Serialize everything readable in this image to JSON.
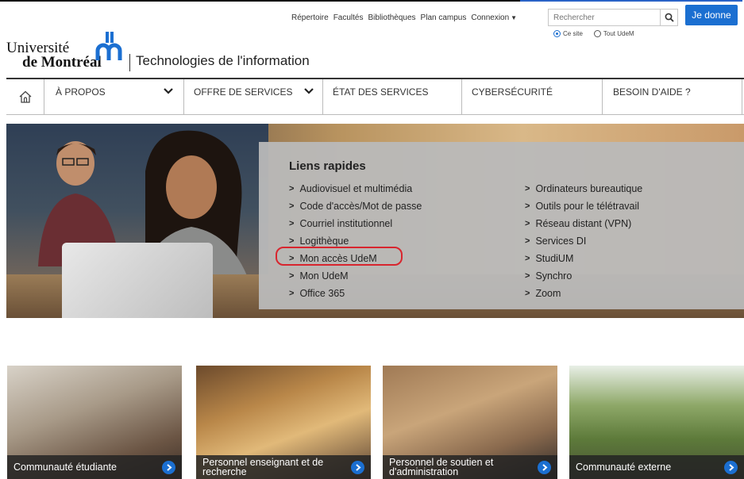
{
  "top_links": {
    "repertoire": "Répertoire",
    "facultes": "Facultés",
    "bibliotheques": "Bibliothèques",
    "plan_campus": "Plan campus",
    "connexion": "Connexion"
  },
  "search": {
    "placeholder": "Rechercher",
    "scope_site": "Ce site",
    "scope_all": "Tout UdeM",
    "selected_scope": "Ce site"
  },
  "give_button": "Je donne",
  "brand": {
    "line1": "Université",
    "line2": "de Montréal",
    "unit": "Technologies de l'information"
  },
  "nav": [
    {
      "label": "À PROPOS",
      "has_dropdown": true
    },
    {
      "label": "OFFRE DE SERVICES",
      "has_dropdown": true
    },
    {
      "label": "ÉTAT DES SERVICES",
      "has_dropdown": false
    },
    {
      "label": "CYBERSÉCURITÉ",
      "has_dropdown": false
    },
    {
      "label": "BESOIN D'AIDE ?",
      "has_dropdown": false
    }
  ],
  "quick_links": {
    "title": "Liens rapides",
    "col1": [
      "Audiovisuel et multimédia",
      "Code d'accès/Mot de passe",
      "Courriel institutionnel",
      "Logithèque",
      "Mon accès UdeM",
      "Mon UdeM",
      "Office 365"
    ],
    "col2": [
      "Ordinateurs bureautique",
      "Outils pour le télétravail",
      "Réseau distant (VPN)",
      "Services DI",
      "StudiUM",
      "Synchro",
      "Zoom"
    ],
    "highlighted": "Mon accès UdeM"
  },
  "cards": [
    {
      "label": "Communauté étudiante"
    },
    {
      "label": "Personnel enseignant et de recherche"
    },
    {
      "label": "Personnel de soutien et d'administration"
    },
    {
      "label": "Communauté externe"
    }
  ],
  "colors": {
    "accent_blue": "#1b6fd1",
    "highlight_red": "#d8252e",
    "panel_gray": "#b9b9b9"
  }
}
